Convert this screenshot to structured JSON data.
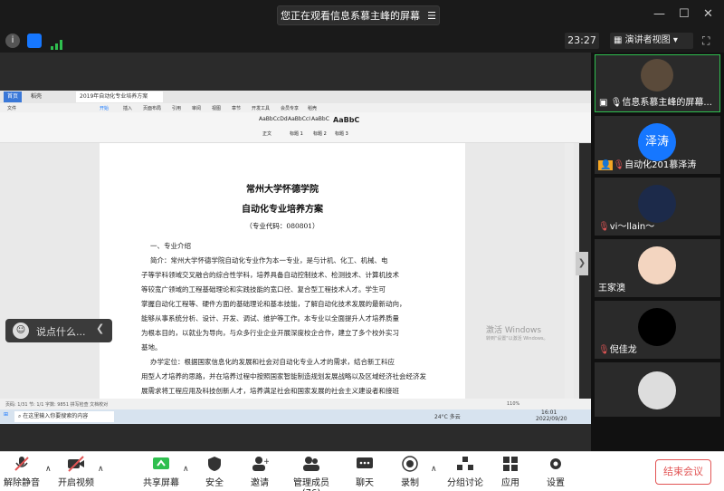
{
  "topbar": {
    "share_banner": "您正在观看信息系慕主峰的屏幕",
    "timer": "23:27",
    "view_button": "演讲者视图"
  },
  "wps": {
    "tabs": [
      "首页",
      "稻壳",
      "2019年自动化专业培养方案"
    ],
    "menu": [
      "文件",
      "开始",
      "插入",
      "页面布局",
      "引用",
      "审阅",
      "视图",
      "章节",
      "开发工具",
      "会员专享",
      "稻壳"
    ],
    "styles": [
      "AaBbCcDd",
      "AaBbCcI",
      "AaBbC",
      "AaBbC"
    ],
    "style_names": [
      "正文",
      "标题 1",
      "标题 2",
      "标题 3"
    ],
    "status_left": "页码: 1/31  节: 1/1  字数: 9851  拼写检查  文档校对",
    "zoom": "110%",
    "taskbar_search": "在这里输入你要搜索的内容",
    "weather": "24°C 多云",
    "time": "16:01",
    "date": "2022/09/20"
  },
  "document": {
    "title1": "常州大学怀德学院",
    "title2": "自动化专业培养方案",
    "code": "（专业代码：080801）",
    "section1": "一、专业介绍",
    "lines": [
      "简介：常州大学怀德学院自动化专业作为本一专业，是与计机、化工、机械、电",
      "子等学科领域交叉融合的综合性学科，培养具备自动控制技术、检测技术、计算机技术",
      "等较宽广领域的工程基础理论和实践技能的宽口径、复合型工程技术人才。学生可",
      "掌握自动化工程等、硬件方面的基础理论和基本技能，了解自动化技术发展的最新动向，",
      "能够从事系统分析、设计、开发、调试、维护等工作。本专业以全面提升人才培养质量",
      "为根本目的，以就业为导向，与众多行业企业开展深度校企合作，建立了多个校外实习",
      "基地。",
      "办学定位：根据国家信息化的发展和社会对自动化专业人才的需求，结合新工科应",
      "用型人才培养的思路，并在培养过程中按照国家智能制造规划发展战略以及区域经济社会经济发",
      "展需求将工程应用及科技创新人才，培养满足社会和国家发展的社会主义建设者和接班"
    ]
  },
  "watermark": {
    "line1": "激活 Windows",
    "line2": "转到\"设置\"以激活 Windows。"
  },
  "chat_placeholder": "说点什么...",
  "participants": [
    {
      "name": "信息系慕主峰的屏幕..."
    },
    {
      "name": "自动化201慕泽涛",
      "avatar_text": "泽涛"
    },
    {
      "name": "vi～llain～"
    },
    {
      "name": "王家澳"
    },
    {
      "name": "倪佳龙"
    }
  ],
  "toolbar": {
    "unmute": "解除静音",
    "video": "开启视频",
    "share": "共享屏幕",
    "security": "安全",
    "invite": "邀请",
    "members": "管理成员(76)",
    "chat": "聊天",
    "record": "录制",
    "breakout": "分组讨论",
    "apps": "应用",
    "settings": "设置",
    "end": "结束会议"
  },
  "colors": {
    "accent_blue": "#1677ff",
    "end_red": "#e25555",
    "green": "#2fbf4f"
  }
}
